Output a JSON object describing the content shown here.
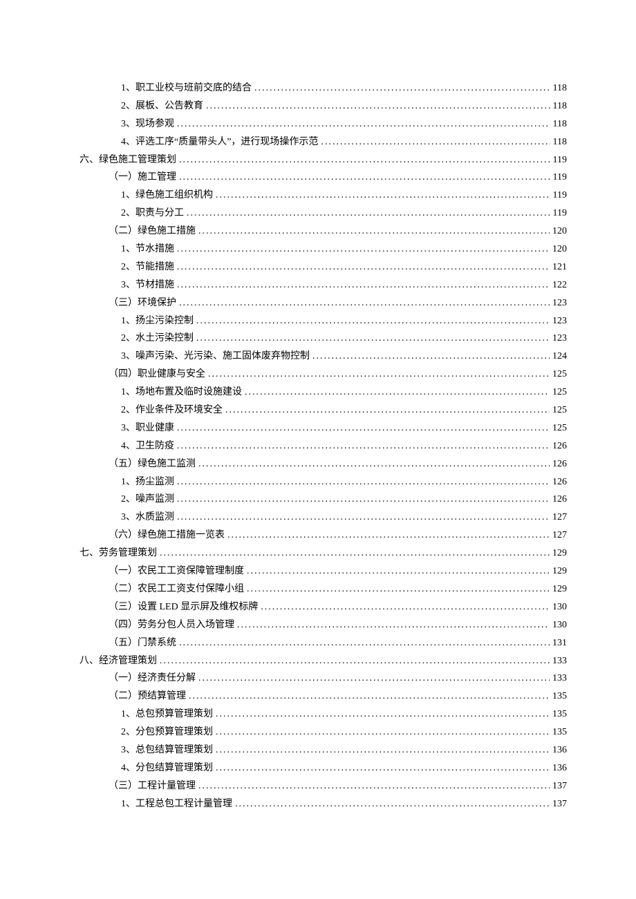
{
  "toc": [
    {
      "level": 3,
      "label": "1、职工业校与班前交底的结合",
      "page": "118"
    },
    {
      "level": 3,
      "label": "2、展板、公告教育",
      "page": "118"
    },
    {
      "level": 3,
      "label": "3、现场参观",
      "page": "118"
    },
    {
      "level": 3,
      "label": "4、评选工序“质量带头人”，进行现场操作示范",
      "page": "118"
    },
    {
      "level": 1,
      "label": "六、绿色施工管理策划",
      "page": "119"
    },
    {
      "level": 2,
      "label": "（一）施工管理",
      "page": "119"
    },
    {
      "level": 3,
      "label": "1、绿色施工组织机构",
      "page": "119"
    },
    {
      "level": 3,
      "label": "2、职责与分工",
      "page": "119"
    },
    {
      "level": 2,
      "label": "（二）绿色施工措施",
      "page": "120"
    },
    {
      "level": 3,
      "label": "1、节水措施",
      "page": "120"
    },
    {
      "level": 3,
      "label": "2、节能措施",
      "page": "121"
    },
    {
      "level": 3,
      "label": "3、节材措施",
      "page": "122"
    },
    {
      "level": 2,
      "label": "（三）环境保护",
      "page": "123"
    },
    {
      "level": 3,
      "label": "1、扬尘污染控制",
      "page": "123"
    },
    {
      "level": 3,
      "label": "2、水土污染控制",
      "page": "123"
    },
    {
      "level": 3,
      "label": "3、噪声污染、光污染、施工固体废弃物控制",
      "page": "124"
    },
    {
      "level": 2,
      "label": "（四）职业健康与安全",
      "page": "125"
    },
    {
      "level": 3,
      "label": "1、场地布置及临时设施建设",
      "page": "125"
    },
    {
      "level": 3,
      "label": "2、作业条件及环境安全",
      "page": "125"
    },
    {
      "level": 3,
      "label": "3、职业健康",
      "page": "125"
    },
    {
      "level": 3,
      "label": "4、卫生防疫",
      "page": "126"
    },
    {
      "level": 2,
      "label": "（五）绿色施工监测",
      "page": "126"
    },
    {
      "level": 3,
      "label": "1、扬尘监测",
      "page": "126"
    },
    {
      "level": 3,
      "label": "2、噪声监测",
      "page": "126"
    },
    {
      "level": 3,
      "label": "3、水质监测",
      "page": "127"
    },
    {
      "level": 2,
      "label": "（六）绿色施工措施一览表",
      "page": "127"
    },
    {
      "level": 1,
      "label": "七、劳务管理策划",
      "page": "129"
    },
    {
      "level": 2,
      "label": "（一）农民工工资保障管理制度",
      "page": "129"
    },
    {
      "level": 2,
      "label": "（二）农民工工资支付保障小组",
      "page": "129"
    },
    {
      "level": 2,
      "label": "（三）设置 LED 显示屏及维权标牌",
      "page": "130"
    },
    {
      "level": 2,
      "label": "（四）劳务分包人员入场管理",
      "page": "130"
    },
    {
      "level": 2,
      "label": "（五）门禁系统",
      "page": "131"
    },
    {
      "level": 1,
      "label": "八、经济管理策划",
      "page": "133"
    },
    {
      "level": 2,
      "label": "（一）经济责任分解",
      "page": "133"
    },
    {
      "level": 2,
      "label": "（二）预结算管理",
      "page": "135"
    },
    {
      "level": 3,
      "label": "1、总包预算管理策划",
      "page": "135"
    },
    {
      "level": 3,
      "label": "2、分包预算管理策划",
      "page": "135"
    },
    {
      "level": 3,
      "label": "3、总包结算管理策划",
      "page": "136"
    },
    {
      "level": 3,
      "label": "4、分包结算管理策划",
      "page": "136"
    },
    {
      "level": 2,
      "label": "（三）工程计量管理",
      "page": "137"
    },
    {
      "level": 3,
      "label": "1、工程总包工程计量管理",
      "page": "137"
    }
  ]
}
